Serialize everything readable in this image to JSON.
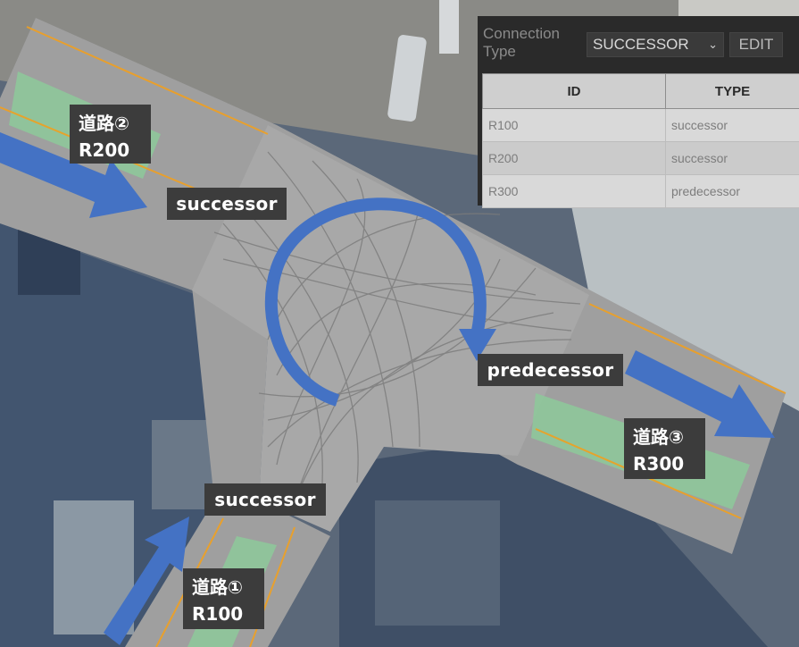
{
  "labels": {
    "successor_left": "successor",
    "successor_bottom": "successor",
    "predecessor": "predecessor",
    "road1_name": "道路①",
    "road1_id": "R100",
    "road2_name": "道路②",
    "road2_id": "R200",
    "road3_name": "道路③",
    "road3_id": "R300"
  },
  "panel": {
    "connection_type_label": "Connection Type",
    "connection_type_value": "SUCCESSOR",
    "edit_label": "EDIT",
    "columns": [
      "ID",
      "TYPE"
    ],
    "rows": [
      {
        "id": "R100",
        "type": "successor"
      },
      {
        "id": "R200",
        "type": "successor"
      },
      {
        "id": "R300",
        "type": "predecessor"
      }
    ]
  },
  "colors": {
    "arrow": "#4472c4",
    "road": "#9e9e9e",
    "lane_line": "#f0a020",
    "green_lane": "#8ec79a",
    "label_bg": "#3c3c3c",
    "panel_bg": "#2a2a2a"
  }
}
